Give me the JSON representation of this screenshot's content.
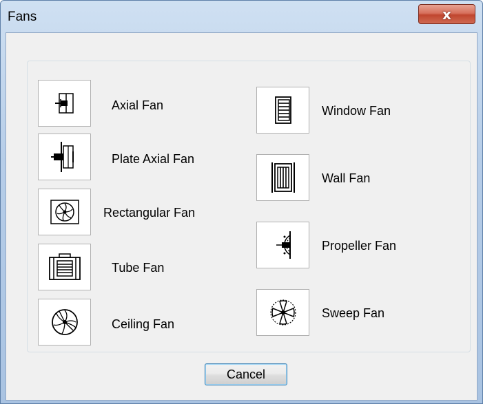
{
  "window": {
    "title": "Fans",
    "close_label": "x"
  },
  "fans": {
    "left": [
      {
        "label": "Axial Fan",
        "icon": "axial-fan-icon"
      },
      {
        "label": "Plate Axial Fan",
        "icon": "plate-axial-fan-icon"
      },
      {
        "label": "Rectangular Fan",
        "icon": "rectangular-fan-icon"
      },
      {
        "label": "Tube Fan",
        "icon": "tube-fan-icon"
      },
      {
        "label": "Ceiling Fan",
        "icon": "ceiling-fan-icon"
      }
    ],
    "right": [
      {
        "label": "Window Fan",
        "icon": "window-fan-icon"
      },
      {
        "label": "Wall Fan",
        "icon": "wall-fan-icon"
      },
      {
        "label": "Propeller Fan",
        "icon": "propeller-fan-icon"
      },
      {
        "label": "Sweep Fan",
        "icon": "sweep-fan-icon"
      }
    ]
  },
  "buttons": {
    "cancel_label": "Cancel"
  }
}
